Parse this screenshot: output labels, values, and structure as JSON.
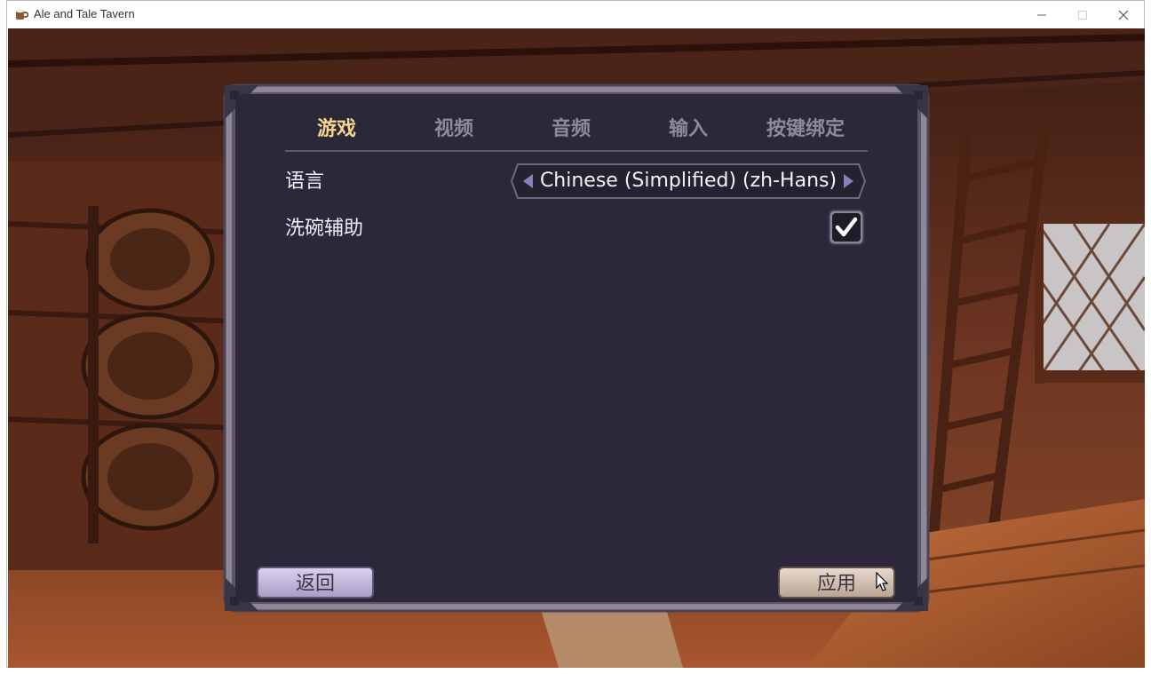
{
  "window": {
    "title": "Ale and Tale Tavern",
    "icon": "ale-mug-icon"
  },
  "settings": {
    "tabs": [
      {
        "label": "游戏",
        "active": true
      },
      {
        "label": "视频",
        "active": false
      },
      {
        "label": "音频",
        "active": false
      },
      {
        "label": "输入",
        "active": false
      },
      {
        "label": "按键绑定",
        "active": false
      }
    ],
    "language_label": "语言",
    "language_value": "Chinese (Simplified) (zh-Hans)",
    "dish_assist_label": "洗碗辅助",
    "dish_assist_checked": true
  },
  "buttons": {
    "back_label": "返回",
    "apply_label": "应用"
  },
  "colors": {
    "panel_bg": "#2c2839",
    "active_tab": "#f3d58f",
    "inactive_tab": "#8e8a99",
    "arrow": "#8c7fbf",
    "back_button": "#c9bfe0",
    "apply_button": "#d6c6b8"
  }
}
